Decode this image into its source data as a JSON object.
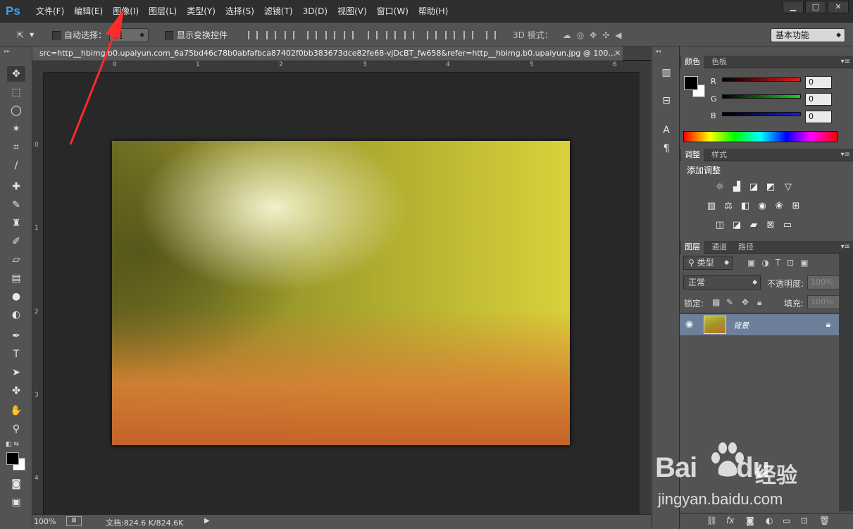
{
  "app": {
    "logo": "Ps",
    "menus": [
      "文件(F)",
      "编辑(E)",
      "图像(I)",
      "图层(L)",
      "类型(Y)",
      "选择(S)",
      "滤镜(T)",
      "3D(D)",
      "视图(V)",
      "窗口(W)",
      "帮助(H)"
    ],
    "window_buttons": [
      "▁",
      "□",
      "✕"
    ]
  },
  "options": {
    "auto_select_label": "自动选择：",
    "auto_select_value": "组",
    "show_transform_label": "显示变换控件",
    "mode_3d_label": "3D 模式：",
    "workspace": "基本功能"
  },
  "document": {
    "tab_title": "src=http__hbimg.b0.upaiyun.com_6a75bd46c78b0abfafbca87402f0bb383673dce82fe68-vjDcBT_fw658&refer=http__hbimg.b0.upaiyun.jpg @ 100...",
    "tab_close": "✕",
    "ruler_h": [
      "0",
      "1",
      "2",
      "3",
      "4",
      "5",
      "6"
    ],
    "ruler_v": [
      "0",
      "1",
      "2",
      "3",
      "4"
    ],
    "canvas_colors": {
      "top_left": "#6f6d22",
      "highlight": "#f2f0c9",
      "top_right": "#d9d23a",
      "middle": "#9c9b2a",
      "bottom": "#c4632a"
    }
  },
  "status": {
    "zoom": "100%",
    "doc_info": "文档:824.6 K/824.6K",
    "arrow": "▶"
  },
  "color_panel": {
    "tabs": [
      "颜色",
      "色板"
    ],
    "channels": [
      {
        "label": "R",
        "value": "0",
        "color": "#e01b1b"
      },
      {
        "label": "G",
        "value": "0",
        "color": "#1bd01b"
      },
      {
        "label": "B",
        "value": "0",
        "color": "#1b1be0"
      }
    ]
  },
  "adjust_panel": {
    "tabs": [
      "调整",
      "样式"
    ],
    "title": "添加调整",
    "row1": [
      "brightness-icon",
      "levels-icon",
      "curves-icon",
      "exposure-icon",
      "vibrance-icon"
    ],
    "row2": [
      "hue-icon",
      "balance-icon",
      "bw-icon",
      "photo-filter-icon",
      "mixer-icon",
      "lookup-icon"
    ],
    "row3": [
      "invert-icon",
      "posterize-icon",
      "threshold-icon",
      "selective-icon",
      "gradient-map-icon"
    ]
  },
  "layers_panel": {
    "tabs": [
      "图层",
      "通道",
      "路径"
    ],
    "filter_label": "类型",
    "blend_mode": "正常",
    "opacity_label": "不透明度:",
    "opacity_value": "100%",
    "lock_label": "锁定:",
    "fill_label": "填充:",
    "fill_value": "100%",
    "layers": [
      {
        "name": "背景",
        "visible": true,
        "locked": true
      }
    ]
  },
  "watermark": {
    "brand": "Bai",
    "brand_suffix": "du",
    "cn": "经验",
    "url": "jingyan.baidu.com"
  }
}
